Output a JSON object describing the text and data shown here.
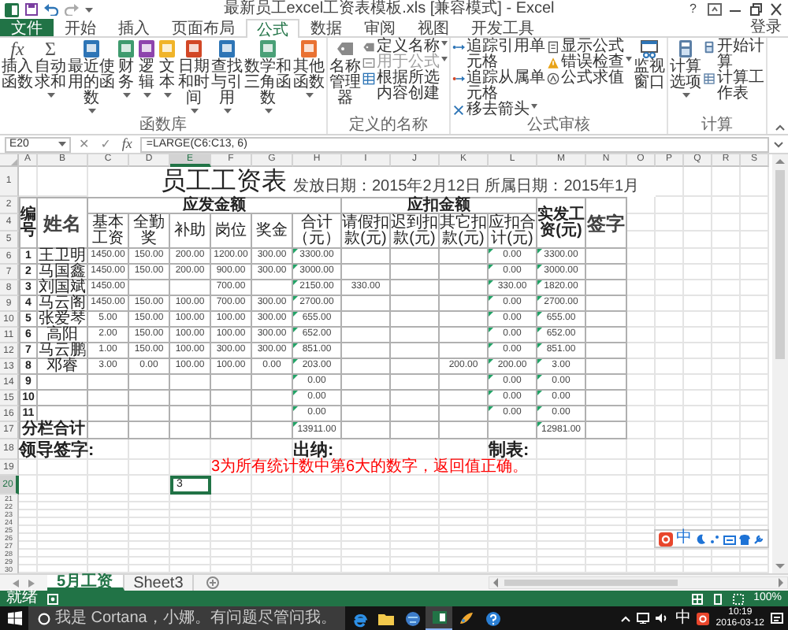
{
  "window": {
    "title": "最新员工excel工资表模板.xls [兼容模式] - Excel",
    "help": "?"
  },
  "ribbon_tabs": [
    {
      "label": "文件",
      "kind": "file",
      "selected": false
    },
    {
      "label": "开始",
      "kind": "tab",
      "selected": false
    },
    {
      "label": "插入",
      "kind": "tab",
      "selected": false
    },
    {
      "label": "页面布局",
      "kind": "tab",
      "selected": false
    },
    {
      "label": "公式",
      "kind": "tab",
      "selected": true
    },
    {
      "label": "数据",
      "kind": "tab",
      "selected": false
    },
    {
      "label": "审阅",
      "kind": "tab",
      "selected": false
    },
    {
      "label": "视图",
      "kind": "tab",
      "selected": false
    },
    {
      "label": "开发工具",
      "kind": "tab",
      "selected": false
    }
  ],
  "account": "登录",
  "ribbon": {
    "groups": [
      {
        "label": "函数库",
        "items": [
          {
            "kind": "large",
            "label": "插入函数",
            "glyph": "fx",
            "menu": false
          },
          {
            "kind": "large",
            "label": "自动求和",
            "glyph": "Σ",
            "menu": true
          },
          {
            "kind": "large",
            "label": "最近使用的函数",
            "menu": true
          },
          {
            "kind": "large",
            "label": "财务",
            "menu": true
          },
          {
            "kind": "large",
            "label": "逻辑",
            "menu": true
          },
          {
            "kind": "large",
            "label": "文本",
            "menu": true
          },
          {
            "kind": "large",
            "label": "日期和时间",
            "menu": true
          },
          {
            "kind": "large",
            "label": "查找与引用",
            "menu": true
          },
          {
            "kind": "large",
            "label": "数学和三角函数",
            "menu": true
          },
          {
            "kind": "large",
            "label": "其他函数",
            "menu": true
          }
        ]
      },
      {
        "label": "定义的名称",
        "items": [
          {
            "kind": "large",
            "label": "名称管理器",
            "menu": false,
            "disabled": false
          },
          {
            "kind": "small",
            "label": "定义名称",
            "menu": true,
            "disabled": false
          },
          {
            "kind": "small",
            "label": "用于公式",
            "menu": true,
            "disabled": true
          },
          {
            "kind": "small",
            "label": "根据所选内容创建",
            "menu": false,
            "disabled": false
          }
        ]
      },
      {
        "label": "公式审核",
        "items": [
          {
            "kind": "small",
            "label": "追踪引用单元格",
            "menu": false
          },
          {
            "kind": "small",
            "label": "追踪从属单元格",
            "menu": false
          },
          {
            "kind": "small",
            "label": "移去箭头",
            "menu": true
          },
          {
            "kind": "small",
            "label": "显示公式",
            "menu": false
          },
          {
            "kind": "small",
            "label": "错误检查",
            "menu": true
          },
          {
            "kind": "small",
            "label": "公式求值",
            "menu": false
          },
          {
            "kind": "large",
            "label": "监视窗口",
            "menu": false
          }
        ]
      },
      {
        "label": "计算",
        "items": [
          {
            "kind": "large",
            "label": "计算选项",
            "menu": true
          },
          {
            "kind": "small",
            "label": "开始计算",
            "menu": false
          },
          {
            "kind": "small",
            "label": "计算工作表",
            "menu": false
          }
        ]
      }
    ]
  },
  "formula_bar": {
    "name_box": "E20",
    "buttons": [
      {
        "kind": "cancel",
        "label": "✕"
      },
      {
        "kind": "enter",
        "label": "✓"
      },
      {
        "kind": "function",
        "label": "fx"
      }
    ],
    "formula": "=LARGE(C6:C13, 6)"
  },
  "sheet": {
    "columns": [
      {
        "label": "A",
        "selected": false
      },
      {
        "label": "B",
        "selected": false
      },
      {
        "label": "C",
        "selected": false
      },
      {
        "label": "D",
        "selected": false
      },
      {
        "label": "E",
        "selected": true
      },
      {
        "label": "F",
        "selected": false
      },
      {
        "label": "G",
        "selected": false
      },
      {
        "label": "H",
        "selected": false
      },
      {
        "label": "I",
        "selected": false
      },
      {
        "label": "J",
        "selected": false
      },
      {
        "label": "K",
        "selected": false
      },
      {
        "label": "L",
        "selected": false
      },
      {
        "label": "M",
        "selected": false
      },
      {
        "label": "N",
        "selected": false
      },
      {
        "label": "O",
        "selected": false
      },
      {
        "label": "P",
        "selected": false
      },
      {
        "label": "Q",
        "selected": false
      },
      {
        "label": "R",
        "selected": false
      },
      {
        "label": "S",
        "selected": false
      }
    ],
    "row_numbers": [
      {
        "label": "1",
        "selected": false
      },
      {
        "label": "2",
        "selected": false
      },
      {
        "label": "4",
        "selected": false
      },
      {
        "label": "5",
        "selected": false
      },
      {
        "label": "6",
        "selected": false
      },
      {
        "label": "7",
        "selected": false
      },
      {
        "label": "8",
        "selected": false
      },
      {
        "label": "9",
        "selected": false
      },
      {
        "label": "10",
        "selected": false
      },
      {
        "label": "11",
        "selected": false
      },
      {
        "label": "12",
        "selected": false
      },
      {
        "label": "13",
        "selected": false
      },
      {
        "label": "14",
        "selected": false
      },
      {
        "label": "15",
        "selected": false
      },
      {
        "label": "16",
        "selected": false
      },
      {
        "label": "17",
        "selected": false
      },
      {
        "label": "18",
        "selected": false
      },
      {
        "label": "19",
        "selected": false
      },
      {
        "label": "20",
        "selected": true
      },
      {
        "label": "21",
        "selected": false
      },
      {
        "label": "22",
        "selected": false
      },
      {
        "label": "23",
        "selected": false
      },
      {
        "label": "24",
        "selected": false
      },
      {
        "label": "25",
        "selected": false
      },
      {
        "label": "26",
        "selected": false
      },
      {
        "label": "27",
        "selected": false
      },
      {
        "label": "28",
        "selected": false
      },
      {
        "label": "29",
        "selected": false
      },
      {
        "label": "30",
        "selected": false
      }
    ],
    "title": "员工工资表",
    "date_line": "发放日期：2015年2月12日 所属日期：2015年1月",
    "headers": {
      "number": "编号",
      "name": "姓名",
      "payable": "应发金额",
      "payable_items": [
        "基本工资",
        "全勤奖",
        "补助",
        "岗位",
        "奖金",
        "合计（元）"
      ],
      "deduction": "应扣金额",
      "deduction_items": [
        "请假扣款(元)",
        "迟到扣款(元)",
        "其它扣款(元)",
        "应扣合计(元)"
      ],
      "net": "实发工资(元)",
      "signature": "签字"
    },
    "rows": [
      {
        "no": "1",
        "name": "王卫明",
        "basic": "1450.00",
        "attendance": "150.00",
        "allowance": "200.00",
        "post": "1200.00",
        "bonus": "300.00",
        "gross": "3300.00",
        "deductions": "0.00",
        "net": "3300.00",
        "error_marks": true
      },
      {
        "no": "2",
        "name": "马国鑫",
        "basic": "1450.00",
        "attendance": "150.00",
        "allowance": "200.00",
        "post": "900.00",
        "bonus": "300.00",
        "gross": "3000.00",
        "deductions": "0.00",
        "net": "3000.00",
        "error_marks": true
      },
      {
        "no": "3",
        "name": "刘国斌",
        "basic": "1450.00",
        "post": "700.00",
        "gross": "2150.00",
        "leave": "330.00",
        "deductions": "330.00",
        "net": "1820.00",
        "error_marks": true
      },
      {
        "no": "4",
        "name": "马云阁",
        "basic": "1450.00",
        "attendance": "150.00",
        "allowance": "100.00",
        "post": "700.00",
        "bonus": "300.00",
        "gross": "2700.00",
        "deductions": "0.00",
        "net": "2700.00",
        "error_marks": true
      },
      {
        "no": "5",
        "name": "张爱琴",
        "basic": "5.00",
        "attendance": "150.00",
        "allowance": "100.00",
        "post": "100.00",
        "bonus": "300.00",
        "gross": "655.00",
        "deductions": "0.00",
        "net": "655.00",
        "error_marks": true
      },
      {
        "no": "6",
        "name": "高阳",
        "basic": "2.00",
        "attendance": "150.00",
        "allowance": "100.00",
        "post": "100.00",
        "bonus": "300.00",
        "gross": "652.00",
        "deductions": "0.00",
        "net": "652.00",
        "error_marks": true
      },
      {
        "no": "7",
        "name": "马云鹏",
        "basic": "1.00",
        "attendance": "150.00",
        "allowance": "100.00",
        "post": "300.00",
        "bonus": "300.00",
        "gross": "851.00",
        "deductions": "0.00",
        "net": "851.00",
        "error_marks": true
      },
      {
        "no": "8",
        "name": "邓睿",
        "basic": "3.00",
        "attendance": "0.00",
        "allowance": "100.00",
        "post": "100.00",
        "bonus": "0.00",
        "gross": "203.00",
        "other": "200.00",
        "deductions": "200.00",
        "net": "3.00",
        "error_marks": true
      },
      {
        "no": "9",
        "gross": "0.00",
        "deductions": "0.00",
        "net": "0.00",
        "error_marks": true
      },
      {
        "no": "10",
        "gross": "0.00",
        "deductions": "0.00",
        "net": "0.00",
        "error_marks": true
      },
      {
        "no": "11",
        "gross": "0.00",
        "deductions": "0.00",
        "net": "0.00",
        "error_marks": true
      }
    ],
    "total": {
      "label": "分栏合计",
      "pay_total": "13911.00",
      "net_total": "12981.00",
      "error_marks": true
    },
    "signatures": [
      "领导签字:",
      "出纳:",
      "制表:"
    ],
    "note": "3为所有统计数中第6大的数字，返回值正确。",
    "active_cell": {
      "value": "3"
    }
  },
  "ime_toolbar": {
    "mode": "中"
  },
  "sheet_tabs": [
    {
      "label": "5月工资",
      "selected": true
    },
    {
      "label": "Sheet3",
      "selected": false
    }
  ],
  "status_bar": {
    "mode": "就绪",
    "zoom": "100%"
  },
  "taskbar": {
    "search": "我是 Cortana，小娜。有问题尽管问我。",
    "apps": [
      {
        "active": false
      },
      {
        "active": false
      },
      {
        "active": false
      },
      {
        "active": true
      },
      {
        "active": false
      },
      {
        "active": false
      }
    ],
    "ime": "中",
    "time": "10:19",
    "date": "2016-03-12"
  }
}
